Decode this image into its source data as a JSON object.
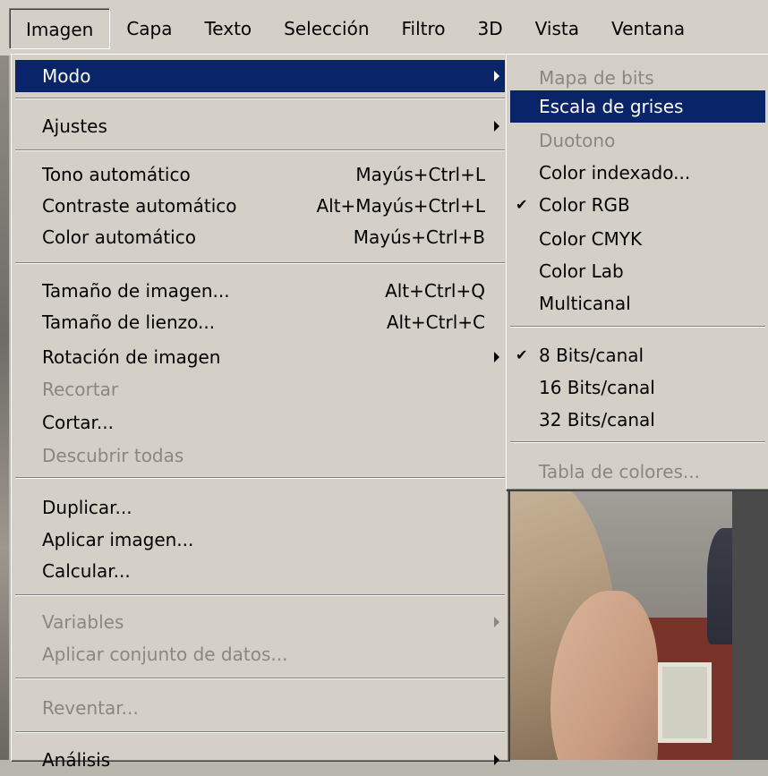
{
  "menubar": {
    "items": [
      {
        "label": "Imagen"
      },
      {
        "label": "Capa"
      },
      {
        "label": "Texto"
      },
      {
        "label": "Selección"
      },
      {
        "label": "Filtro"
      },
      {
        "label": "3D"
      },
      {
        "label": "Vista"
      },
      {
        "label": "Ventana"
      }
    ],
    "active_index": 0
  },
  "imagen_menu": {
    "items": [
      {
        "label": "Modo",
        "submenu": true,
        "highlighted": true
      },
      {
        "label": "Ajustes",
        "submenu": true
      },
      {
        "label": "Tono automático",
        "shortcut": "Mayús+Ctrl+L"
      },
      {
        "label": "Contraste automático",
        "shortcut": "Alt+Mayús+Ctrl+L"
      },
      {
        "label": "Color automático",
        "shortcut": "Mayús+Ctrl+B"
      },
      {
        "label": "Tamaño de imagen...",
        "shortcut": "Alt+Ctrl+Q"
      },
      {
        "label": "Tamaño de lienzo...",
        "shortcut": "Alt+Ctrl+C"
      },
      {
        "label": "Rotación de imagen",
        "submenu": true
      },
      {
        "label": "Recortar",
        "disabled": true
      },
      {
        "label": "Cortar..."
      },
      {
        "label": "Descubrir todas",
        "disabled": true
      },
      {
        "label": "Duplicar..."
      },
      {
        "label": "Aplicar imagen..."
      },
      {
        "label": "Calcular..."
      },
      {
        "label": "Variables",
        "submenu": true,
        "disabled": true
      },
      {
        "label": "Aplicar conjunto de datos...",
        "disabled": true
      },
      {
        "label": "Reventar...",
        "disabled": true
      },
      {
        "label": "Análisis",
        "submenu": true
      }
    ]
  },
  "modo_submenu": {
    "items": [
      {
        "label": "Mapa de bits",
        "disabled": true
      },
      {
        "label": "Escala de grises",
        "highlighted": true
      },
      {
        "label": "Duotono",
        "disabled": true
      },
      {
        "label": "Color indexado..."
      },
      {
        "label": "Color RGB",
        "checked": true
      },
      {
        "label": "Color CMYK"
      },
      {
        "label": "Color Lab"
      },
      {
        "label": "Multicanal"
      },
      {
        "label": "8 Bits/canal",
        "checked": true
      },
      {
        "label": "16 Bits/canal"
      },
      {
        "label": "32 Bits/canal"
      },
      {
        "label": "Tabla de colores...",
        "disabled": true
      }
    ]
  },
  "colors": {
    "menu_bg": "#d4d0c8",
    "highlight": "#0a246a",
    "disabled_text": "#8a8780"
  }
}
